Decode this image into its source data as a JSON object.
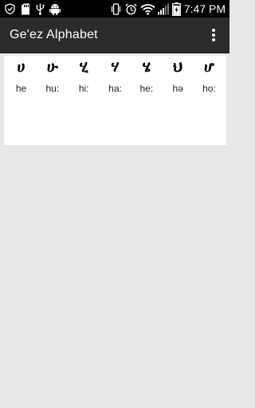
{
  "status_bar": {
    "time": "7:47 PM",
    "icons": [
      "shield-check-icon",
      "storage-card-icon",
      "usb-icon",
      "android-debug-icon",
      "vibrate-icon",
      "alarm-icon",
      "wifi-icon",
      "signal-icon",
      "battery-charging-icon"
    ]
  },
  "action_bar": {
    "title": "Geʹez Alphabet",
    "overflow_icon": "more-vertical-icon"
  },
  "letters": [
    {
      "glyph": "ሀ",
      "translit": "he"
    },
    {
      "glyph": "ሁ",
      "translit": "hu:"
    },
    {
      "glyph": "ሂ",
      "translit": "hi:"
    },
    {
      "glyph": "ሃ",
      "translit": "ha:"
    },
    {
      "glyph": "ሄ",
      "translit": "he:"
    },
    {
      "glyph": "ህ",
      "translit": "hə"
    },
    {
      "glyph": "ሆ",
      "translit": "ho:"
    }
  ]
}
